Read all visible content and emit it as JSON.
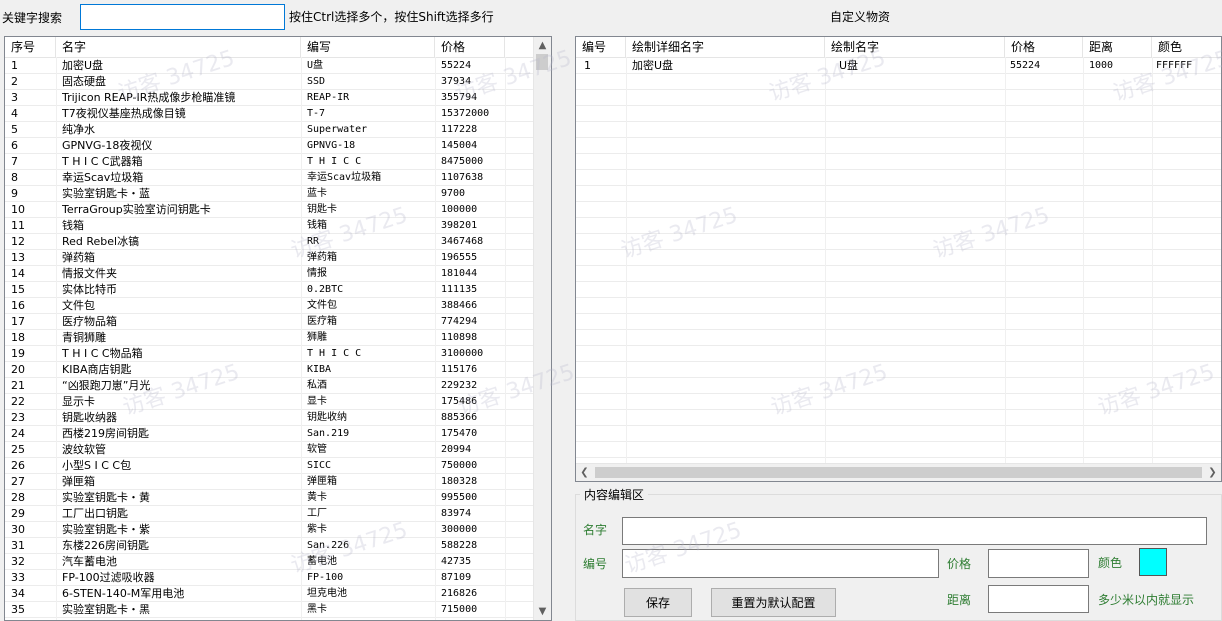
{
  "search": {
    "label": "关键字搜索",
    "value": "",
    "hint": "按住Ctrl选择多个，按住Shift选择多行"
  },
  "custom_title": "自定义物资",
  "left_table": {
    "headers": [
      "序号",
      "名字",
      "编写",
      "价格"
    ],
    "rows": [
      [
        "1",
        "加密U盘",
        "U盘",
        "55224"
      ],
      [
        "2",
        "固态硬盘",
        "SSD",
        "37934"
      ],
      [
        "3",
        "Trijicon REAP-IR热成像步枪瞄准镜",
        "REAP-IR",
        "355794"
      ],
      [
        "4",
        "T7夜视仪基座热成像目镜",
        "T-7",
        "15372000"
      ],
      [
        "5",
        "纯净水",
        "Superwater",
        "117228"
      ],
      [
        "6",
        "GPNVG-18夜视仪",
        "GPNVG-18",
        "145004"
      ],
      [
        "7",
        "T H I C C武器箱",
        "T H I C C",
        "8475000"
      ],
      [
        "8",
        "幸运Scav垃圾箱",
        "幸运Scav垃圾箱",
        "1107638"
      ],
      [
        "9",
        "实验室钥匙卡・蓝",
        "蓝卡",
        "9700"
      ],
      [
        "10",
        "TerraGroup实验室访问钥匙卡",
        "钥匙卡",
        "100000"
      ],
      [
        "11",
        "钱箱",
        "钱箱",
        "398201"
      ],
      [
        "12",
        "Red Rebel冰镐",
        "RR",
        "3467468"
      ],
      [
        "13",
        "弹药箱",
        "弹药箱",
        "196555"
      ],
      [
        "14",
        "情报文件夹",
        "情报",
        "181044"
      ],
      [
        "15",
        "实体比特币",
        "0.2BTC",
        "111135"
      ],
      [
        "16",
        "文件包",
        "文件包",
        "388466"
      ],
      [
        "17",
        "医疗物品箱",
        "医疗箱",
        "774294"
      ],
      [
        "18",
        "青铜狮雕",
        "狮雕",
        "110898"
      ],
      [
        "19",
        "T H I C C物品箱",
        "T H I C C",
        "3100000"
      ],
      [
        "20",
        "KIBA商店钥匙",
        "KIBA",
        "115176"
      ],
      [
        "21",
        "“凶狠跑刀崽”月光",
        "私酒",
        "229232"
      ],
      [
        "22",
        "显示卡",
        "显卡",
        "175486"
      ],
      [
        "23",
        "钥匙收纳器",
        "钥匙收纳",
        "885366"
      ],
      [
        "24",
        "西楼219房间钥匙",
        "San.219",
        "175470"
      ],
      [
        "25",
        "波纹软管",
        "软管",
        "20994"
      ],
      [
        "26",
        "小型S I C C包",
        "SICC",
        "750000"
      ],
      [
        "27",
        "弹匣箱",
        "弹匣箱",
        "180328"
      ],
      [
        "28",
        "实验室钥匙卡・黄",
        "黄卡",
        "995500"
      ],
      [
        "29",
        "工厂出口钥匙",
        "工厂",
        "83974"
      ],
      [
        "30",
        "实验室钥匙卡・紫",
        "紫卡",
        "300000"
      ],
      [
        "31",
        "东楼226房间钥匙",
        "San.226",
        "588228"
      ],
      [
        "32",
        "汽车蓄电池",
        "蓄电池",
        "42735"
      ],
      [
        "33",
        "FP-100过滤吸收器",
        "FP-100",
        "87109"
      ],
      [
        "34",
        "6-STEN-140-M军用电池",
        "坦克电池",
        "216826"
      ],
      [
        "35",
        "实验室钥匙卡・黑",
        "黑卡",
        "715000"
      ]
    ]
  },
  "right_table": {
    "headers": [
      "编号",
      "绘制详细名字",
      "绘制名字",
      "价格",
      "距离",
      "颜色"
    ],
    "rows": [
      [
        "1",
        "加密U盘",
        "U盘",
        "55224",
        "1000",
        "FFFFFF"
      ]
    ]
  },
  "editor": {
    "title": "内容编辑区",
    "name_label": "名字",
    "name_value": "",
    "code_label": "编号",
    "code_value": "",
    "price_label": "价格",
    "price_value": "",
    "color_label": "颜色",
    "color_value": "#00ffff",
    "distance_label": "距离",
    "distance_value": "",
    "distance_hint": "多少米以内就显示",
    "save_button": "保存",
    "reset_button": "重置为默认配置"
  },
  "watermark": "访客 34725"
}
